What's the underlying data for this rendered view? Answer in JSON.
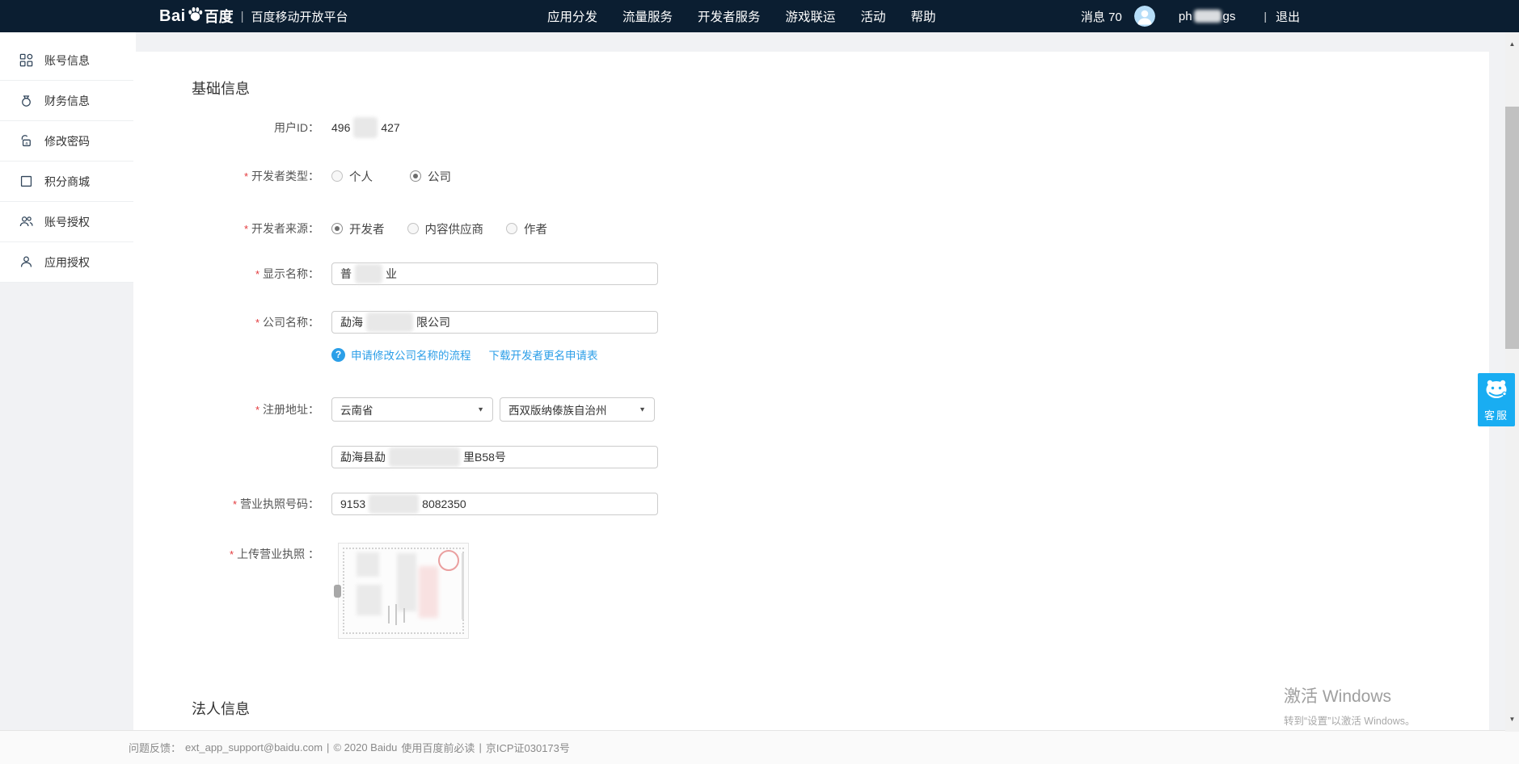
{
  "navbar": {
    "logo": {
      "bai": "Bai",
      "baidu": "百度",
      "divider": "|",
      "platform": "百度移动开放平台"
    },
    "menu": [
      {
        "label": "应用分发"
      },
      {
        "label": "流量服务"
      },
      {
        "label": "开发者服务"
      },
      {
        "label": "游戏联运"
      },
      {
        "label": "活动"
      },
      {
        "label": "帮助"
      }
    ],
    "messages": "消息 70",
    "user": {
      "prefix": "ph",
      "suffix": "gs"
    },
    "pipe": "|",
    "logout": "退出"
  },
  "sidebar": {
    "items": [
      {
        "label": "账号信息",
        "icon": "grid-icon"
      },
      {
        "label": "财务信息",
        "icon": "ring-icon"
      },
      {
        "label": "修改密码",
        "icon": "unlock-icon"
      },
      {
        "label": "积分商城",
        "icon": "box-icon"
      },
      {
        "label": "账号授权",
        "icon": "users-icon"
      },
      {
        "label": "应用授权",
        "icon": "user-icon"
      }
    ]
  },
  "form": {
    "title": "基础信息",
    "required_mark": "*",
    "user_id": {
      "label": "用户ID：",
      "prefix": "496",
      "suffix": "427"
    },
    "developer_type": {
      "label": "开发者类型：",
      "options": [
        {
          "label": "个人",
          "checked": false
        },
        {
          "label": "公司",
          "checked": true
        }
      ]
    },
    "developer_source": {
      "label": "开发者来源：",
      "options": [
        {
          "label": "开发者",
          "checked": true
        },
        {
          "label": "内容供应商",
          "checked": false
        },
        {
          "label": "作者",
          "checked": false
        }
      ]
    },
    "display_name": {
      "label": "显示名称：",
      "prefix": "普",
      "suffix": "业"
    },
    "company_name": {
      "label": "公司名称：",
      "prefix": "勐海",
      "suffix": "限公司"
    },
    "links": {
      "modify": "申请修改公司名称的流程",
      "download": "下载开发者更名申请表"
    },
    "registered_address": {
      "label": "注册地址：",
      "province": "云南省",
      "city": "西双版纳傣族自治州",
      "detail_prefix": "勐海县勐",
      "detail_suffix": "里B58号"
    },
    "license_number": {
      "label": "营业执照号码：",
      "prefix": "9153",
      "suffix": "8082350"
    },
    "license_upload": {
      "label": "上传营业执照 ："
    },
    "section2": "法人信息"
  },
  "service": {
    "label": "客服"
  },
  "watermark": {
    "title": "激活 Windows",
    "subtitle": "转到“设置”以激活 Windows。"
  },
  "footer": {
    "feedback_label": "问题反馈：",
    "email": "ext_app_support@baidu.com",
    "sep1": "|",
    "copyright": "© 2020 Baidu",
    "must_read": "使用百度前必读",
    "sep2": "|",
    "icp": "京ICP证030173号"
  },
  "icons": {
    "select_arrow": "▼",
    "scroll_up": "▲",
    "scroll_down": "▼",
    "help": "?"
  }
}
